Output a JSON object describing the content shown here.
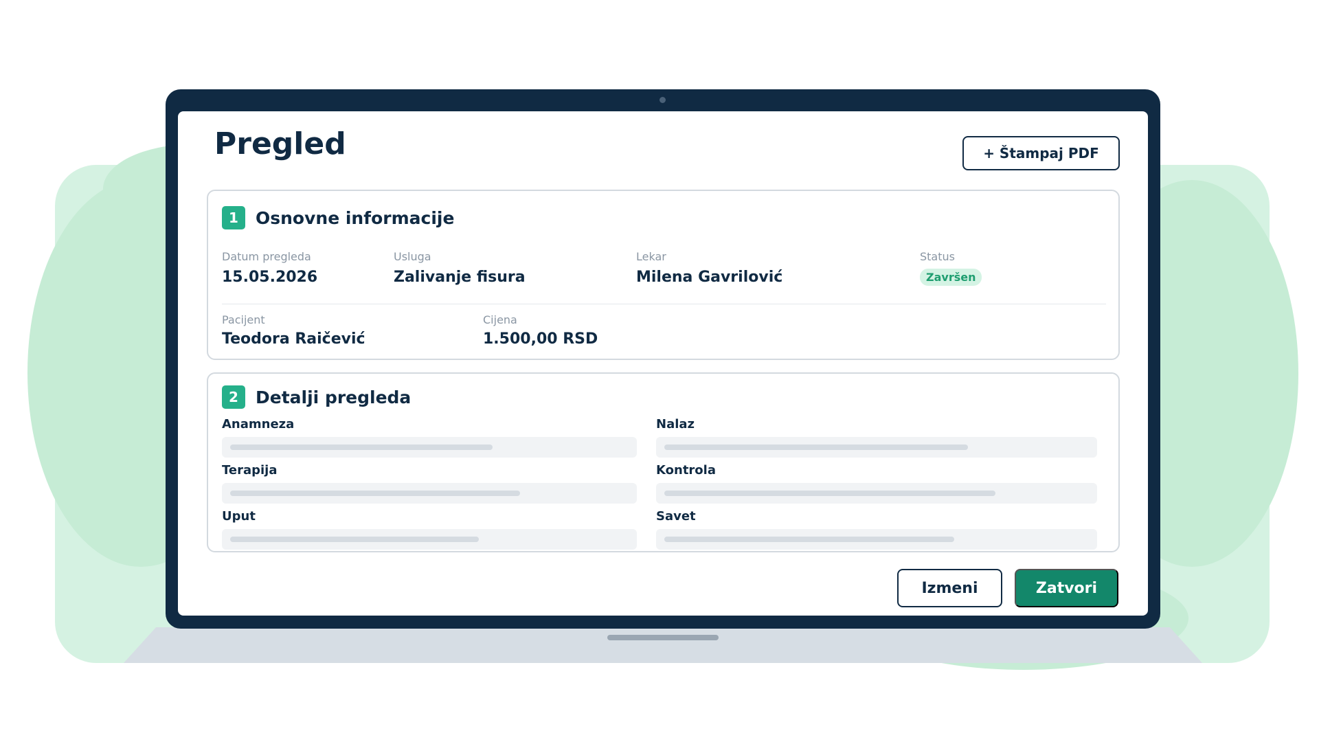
{
  "colors": {
    "primary": "#102a43",
    "accent": "#13876a",
    "step_badge": "#25b08a",
    "status_bg": "#d4f3e4",
    "status_text": "#1f9e70",
    "background_shape": "#d5f2e2"
  },
  "header": {
    "title": "Pregled",
    "print_button": "+ Štampaj PDF"
  },
  "basic_info": {
    "step": "1",
    "title": "Osnovne informacije",
    "fields": [
      {
        "label": "Datum pregleda",
        "value": "15.05.2026"
      },
      {
        "label": "Usluga",
        "value": "Zalivanje fisura"
      },
      {
        "label": "Lekar",
        "value": "Milena Gavrilović"
      },
      {
        "label": "Status",
        "value": "Završen"
      },
      {
        "label": "Pacijent",
        "value": "Teodora Raičević"
      },
      {
        "label": "Cijena",
        "value": "1.500,00 RSD"
      }
    ]
  },
  "details": {
    "step": "2",
    "title": "Detalji pregleda",
    "items": [
      {
        "label": "Anamneza"
      },
      {
        "label": "Nalaz"
      },
      {
        "label": "Terapija"
      },
      {
        "label": "Kontrola"
      },
      {
        "label": "Uput"
      },
      {
        "label": "Savet"
      }
    ]
  },
  "footer": {
    "edit_button": "Izmeni",
    "close_button": "Zatvori"
  }
}
